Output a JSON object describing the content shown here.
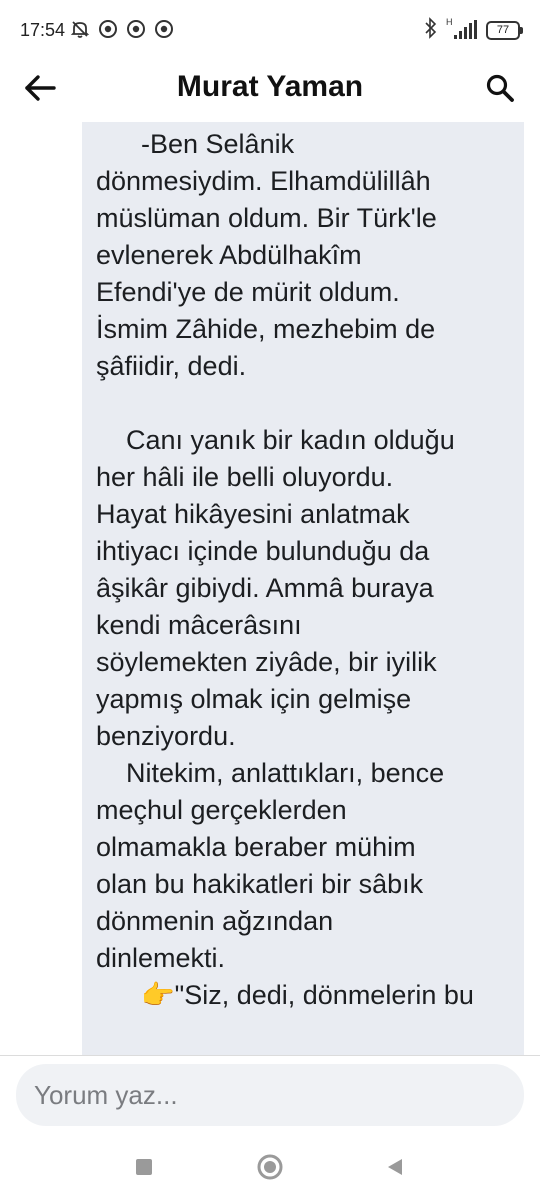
{
  "status_bar": {
    "time": "17:54",
    "battery": "77",
    "network_label": "H",
    "left_icons": [
      "mute-icon",
      "chrome-icon",
      "chrome-icon",
      "chrome-icon"
    ],
    "right_icons": [
      "bluetooth-icon",
      "signal-icon",
      "battery-icon"
    ]
  },
  "header": {
    "title": "Murat Yaman",
    "back_icon": "back-arrow-icon",
    "search_icon": "search-icon"
  },
  "post": {
    "line_a1": "-Ben Selânik",
    "line_a2": "dönmesiydim. Elhamdülillâh",
    "line_a3": "müslüman oldum. Bir Türk'le",
    "line_a4": "evlenerek Abdülhakîm",
    "line_a5": "Efendi'ye de mürit oldum.",
    "line_a6": "İsmim Zâhide, mezhebim de",
    "line_a7": "şâfiidir, dedi.",
    "line_b1": "Canı yanık bir kadın olduğu",
    "line_b2": "her hâli ile belli oluyordu.",
    "line_b3": "Hayat hikâyesini anlatmak",
    "line_b4": "ihtiyacı içinde bulunduğu da",
    "line_b5": "âşikâr gibiydi. Ammâ buraya",
    "line_b6": "kendi mâcerâsını",
    "line_b7": "söylemekten ziyâde, bir iyilik",
    "line_b8": "yapmış olmak için gelmişe",
    "line_b9": "benziyordu.",
    "line_c1": "Nitekim, anlattıkları, bence",
    "line_c2": "meçhul gerçeklerden",
    "line_c3": "olmamakla beraber mühim",
    "line_c4": "olan bu hakikatleri bir sâbık",
    "line_c5": "dönmenin ağzından",
    "line_c6": "dinlemekti.",
    "line_d1_emoji": "👉",
    "line_d1": "\"Siz, dedi, dönmelerin bu"
  },
  "comment": {
    "placeholder": "Yorum yaz..."
  },
  "nav": {
    "icons": [
      "recents-square-icon",
      "home-circle-icon",
      "back-triangle-icon"
    ]
  }
}
